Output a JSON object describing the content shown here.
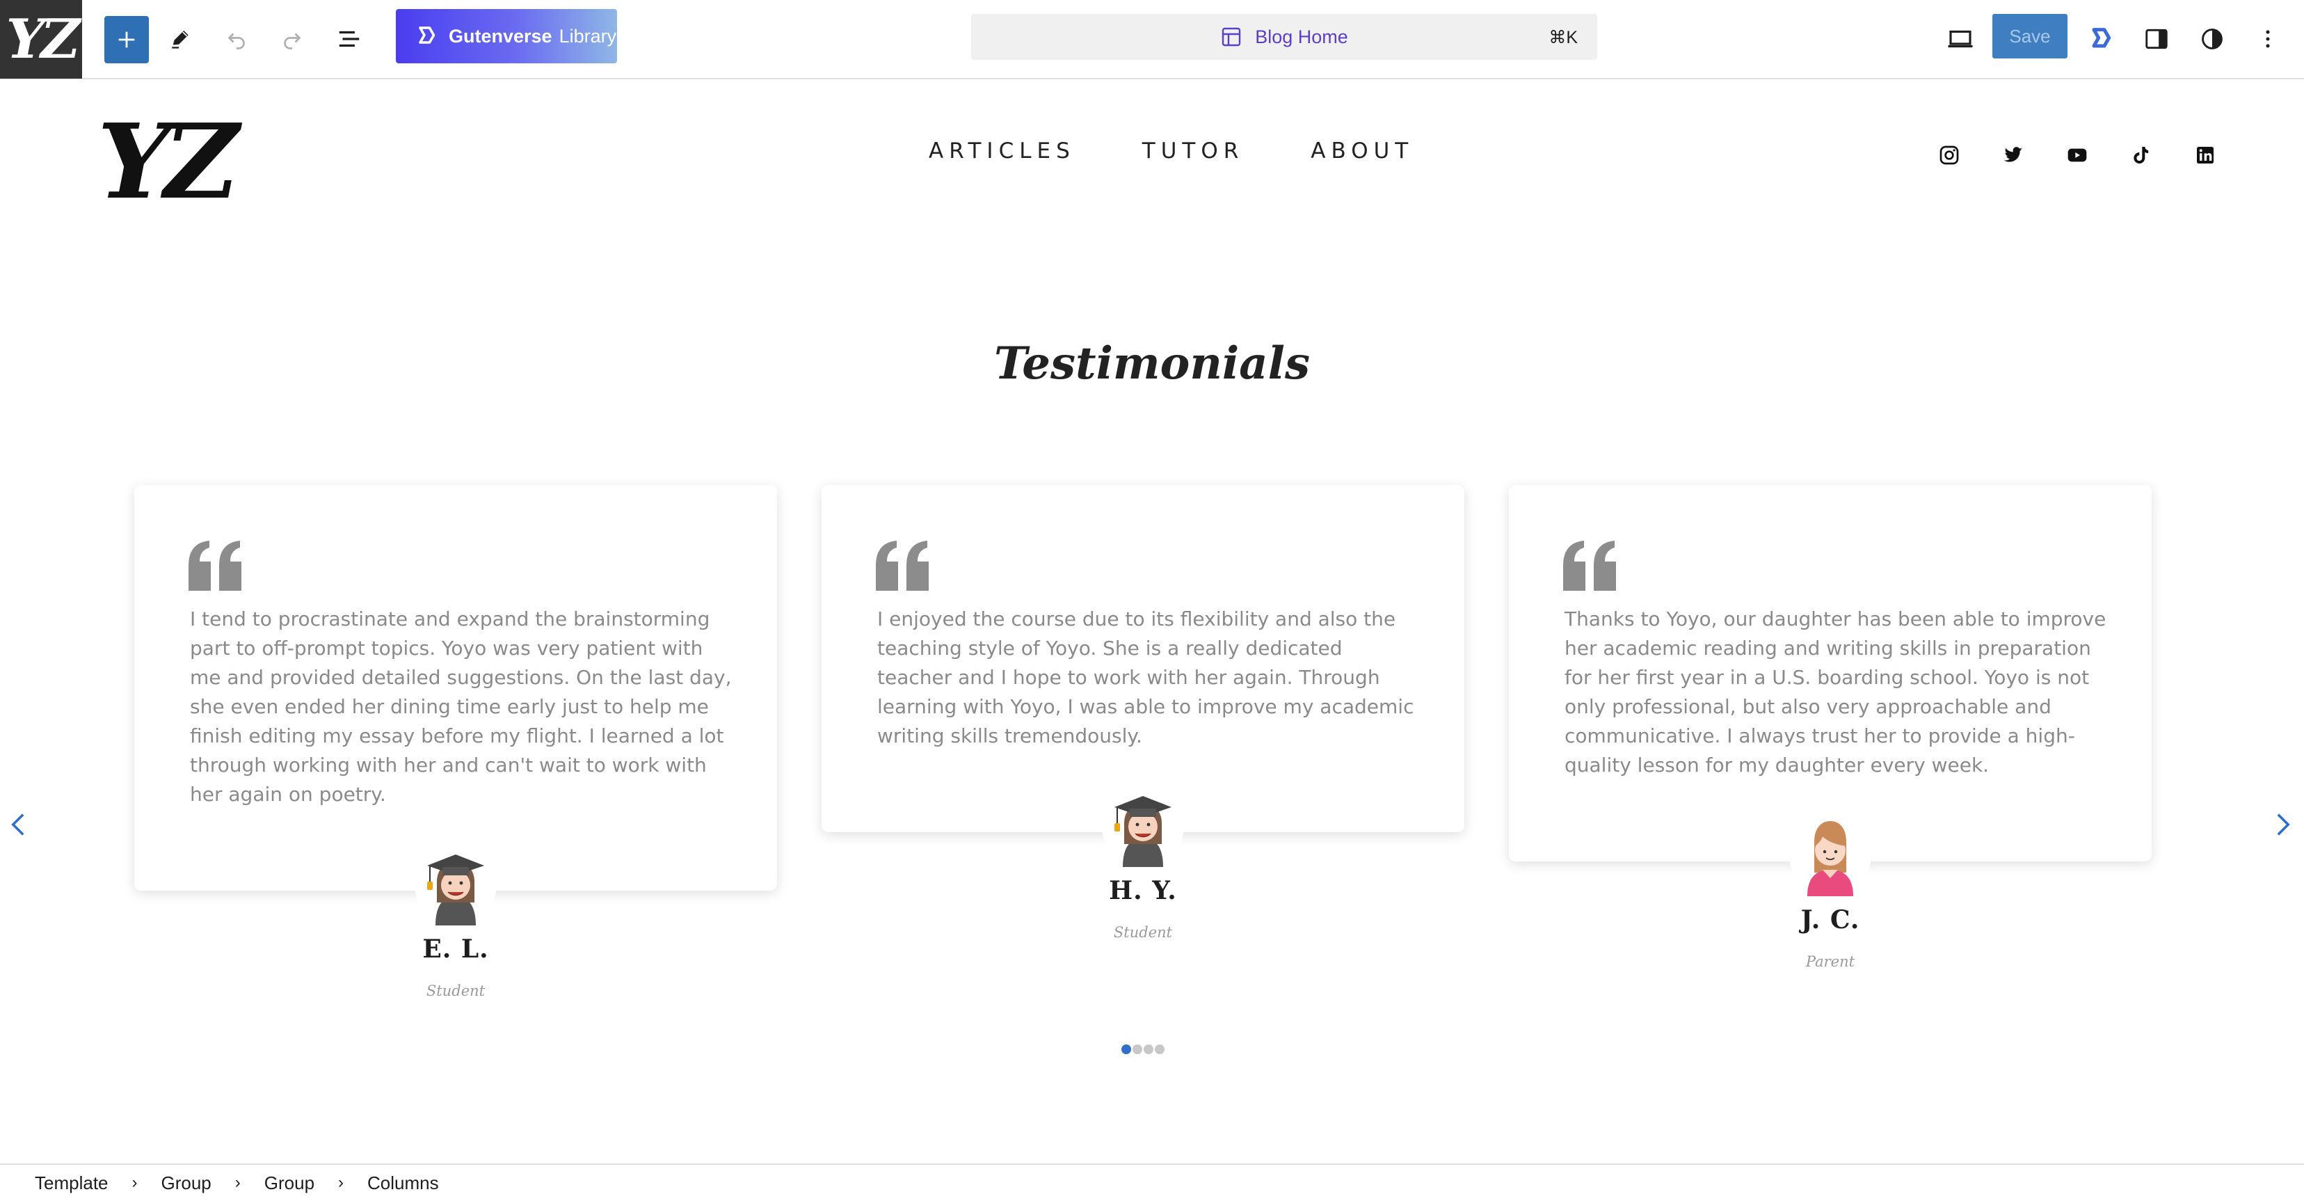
{
  "editor": {
    "site_icon_text": "YZ",
    "library_label_bold": "Gutenverse",
    "library_label_light": "Library",
    "document_title": "Blog Home",
    "command_shortcut": "⌘K",
    "save_label": "Save",
    "icons": [
      "add-block-icon",
      "pencil-icon",
      "undo-icon",
      "redo-icon",
      "list-view-icon",
      "gutenverse-icon",
      "template-icon",
      "desktop-view-icon",
      "gutenverse-logo-icon",
      "settings-panel-icon",
      "styles-icon",
      "more-options-icon"
    ],
    "colors": {
      "add_button": "#2f6fb3",
      "save_button": "#3f7fc1",
      "library_gradient_start": "#4a3df0",
      "library_gradient_end": "#8fb7e6",
      "title_color": "#5b3fc6"
    }
  },
  "site": {
    "logo": "YZ",
    "nav": [
      {
        "label": "ARTICLES"
      },
      {
        "label": "TUTOR"
      },
      {
        "label": "ABOUT"
      }
    ],
    "social_icons": [
      "instagram-icon",
      "twitter-icon",
      "youtube-icon",
      "tiktok-icon",
      "linkedin-icon"
    ]
  },
  "testimonials": {
    "heading": "Testimonials",
    "items": [
      {
        "text": "I tend to procrastinate and expand the brainstorming part to off-prompt topics. Yoyo was very patient with me and provided detailed suggestions. On the last day, she even ended her dining time early just to help me finish editing my essay before my flight. I learned a lot through working with her and can't wait to work with her again on poetry.",
        "name": "E. L.",
        "role": "Student",
        "avatar": "graduate-girl-avatar"
      },
      {
        "text": "I enjoyed the course due to its flexibility and also the teaching style of Yoyo. She is a really dedicated teacher and I hope to work with her again. Through learning with Yoyo, I was able to improve my academic writing skills tremendously.",
        "name": "H. Y.",
        "role": "Student",
        "avatar": "graduate-girl-avatar"
      },
      {
        "text": "Thanks to Yoyo, our daughter has been able to improve her academic reading and writing skills in preparation for her first year in a U.S. boarding school. Yoyo is not only professional, but also very approachable and communicative. I always trust her to provide a high-quality lesson for my daughter every week.",
        "name": "J. C.",
        "role": "Parent",
        "avatar": "parent-woman-avatar"
      }
    ],
    "pagination": {
      "count": 4,
      "active": 1
    }
  },
  "breadcrumb": [
    "Template",
    "Group",
    "Group",
    "Columns"
  ]
}
